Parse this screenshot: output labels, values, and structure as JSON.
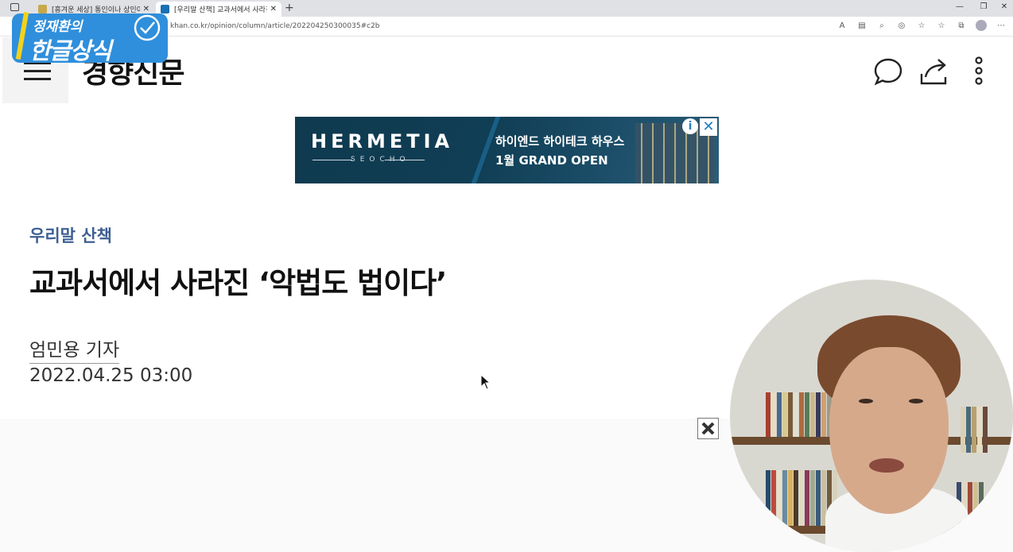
{
  "browser": {
    "tabs": [
      {
        "title": "[흥겨운 세상] 통인이나 상인이나",
        "active": false
      },
      {
        "title": "[우리말 산책] 교과서에서 사라진",
        "active": true
      }
    ],
    "new_tab_icon": "plus-icon",
    "url": "khan.co.kr/opinion/column/article/202204250300035#c2b",
    "window_controls": [
      "minimize-icon",
      "restore-icon",
      "close-icon"
    ],
    "toolbar_icons": [
      "read-aloud-icon",
      "immersive-reader-icon",
      "zoom-icon",
      "tracking-icon",
      "favorite-add-icon",
      "favorites-icon",
      "collections-icon",
      "profile-icon",
      "more-icon"
    ]
  },
  "overlay_logo": {
    "line1": "정재환의",
    "line2": "한글상식",
    "colors": {
      "badge": "#2f8fdc",
      "accent": "#f2d21b"
    }
  },
  "site": {
    "name": "경향신문",
    "header_icons": [
      "comment-icon",
      "share-icon",
      "more-vertical-icon"
    ]
  },
  "ad": {
    "brand": "HERMETIA",
    "brand_sub": "SEOCHO",
    "line1": "하이엔드 하이테크 하우스",
    "line2": "1월 GRAND OPEN",
    "info_glyph": "i",
    "close_glyph": "✕"
  },
  "article": {
    "category": "우리말 산책",
    "headline": "교과서에서 사라진 ‘악법도 법이다’",
    "author": "엄민용 기자",
    "date": "2022.04.25 03:00"
  },
  "floating_ad": {
    "close_icon": "close-icon"
  },
  "colors": {
    "category": "#3d5f92",
    "tab_bar": "#dfe1e5",
    "ad_bg": "#0f3a4f"
  }
}
